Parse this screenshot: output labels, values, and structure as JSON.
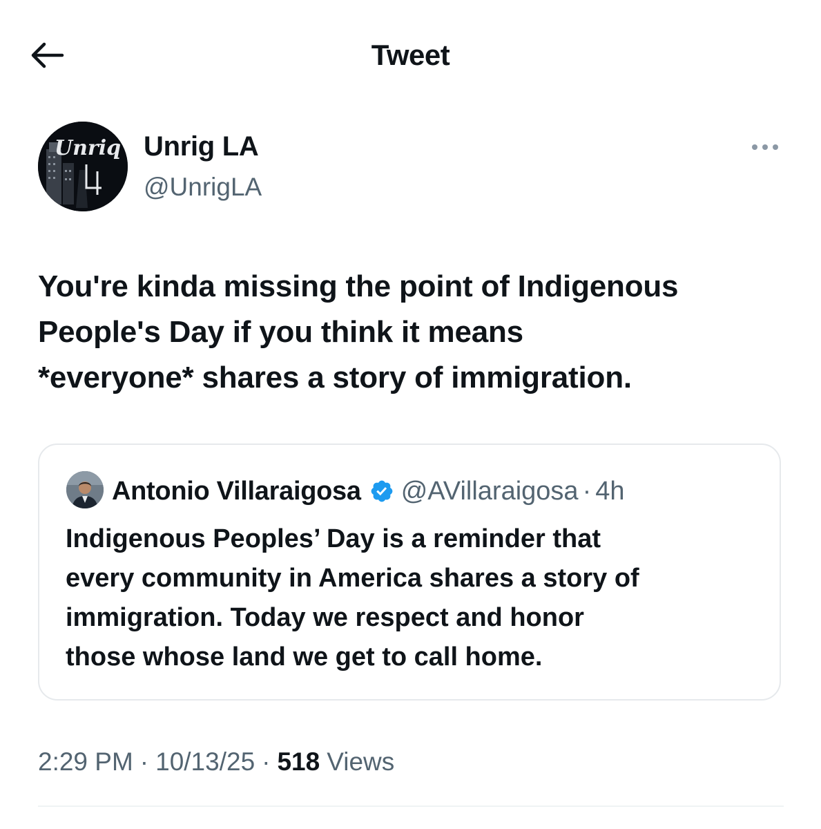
{
  "header": {
    "title": "Tweet",
    "back_icon": "arrow-left-icon"
  },
  "author": {
    "name": "Unrig LA",
    "handle": "@UnrigLA",
    "avatar_logo_text": "Unriq LA",
    "more_icon": "more-horizontal-icon"
  },
  "tweet": {
    "text_lines": [
      "You're kinda missing the point of Indigenous",
      "People's Day if you think it means",
      "*everyone* shares a story of immigration."
    ]
  },
  "quoted_tweet": {
    "name": "Antonio Villaraigosa",
    "verified_icon": "verified-badge-icon",
    "handle": "@AVillaraigosa",
    "separator": "·",
    "time": "4h",
    "text_lines": [
      "Indigenous Peoples’ Day is a reminder that",
      "every community in America shares a story of",
      "immigration. Today we respect and honor",
      "those whose land we get to call home."
    ]
  },
  "meta": {
    "time": "2:29 PM",
    "date": "10/13/25",
    "views_count": "518",
    "views_label": "Views",
    "separator": "·"
  },
  "colors": {
    "text_primary": "#0f1419",
    "text_secondary": "#536471",
    "verified_blue": "#1d9bf0",
    "border": "#e6e9ec"
  }
}
